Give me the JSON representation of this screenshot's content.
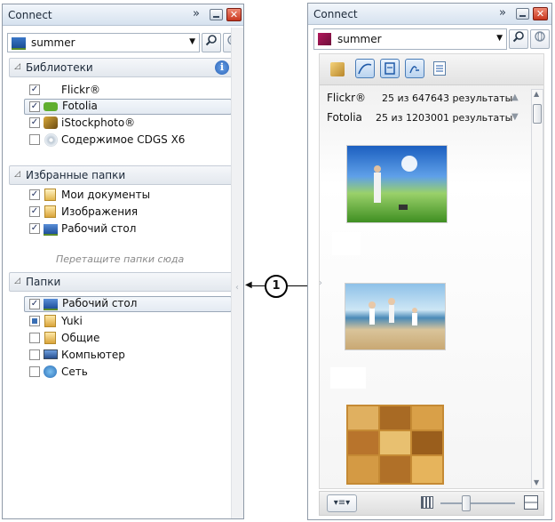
{
  "left_panel": {
    "title": "Connect",
    "search_value": "summer",
    "libraries": {
      "title": "Библиотеки",
      "items": [
        {
          "label": "Flickr®",
          "checked": true
        },
        {
          "label": "Fotolia",
          "checked": true
        },
        {
          "label": "iStockphoto®",
          "checked": true
        },
        {
          "label": "Содержимое CDGS X6",
          "checked": false
        }
      ]
    },
    "favorites": {
      "title": "Избранные папки",
      "items": [
        {
          "label": "Мои документы",
          "checked": true
        },
        {
          "label": "Изображения",
          "checked": true
        },
        {
          "label": "Рабочий стол",
          "checked": true
        }
      ],
      "drop_hint": "Перетащите папки сюда"
    },
    "folders": {
      "title": "Папки",
      "items": [
        {
          "label": "Рабочий стол",
          "checked": true
        },
        {
          "label": "Yuki",
          "checked": "partial"
        },
        {
          "label": "Общие",
          "checked": false
        },
        {
          "label": "Компьютер",
          "checked": false
        },
        {
          "label": "Сеть",
          "checked": false
        }
      ]
    }
  },
  "right_panel": {
    "title": "Connect",
    "search_value": "summer",
    "results": [
      {
        "source": "Flickr®",
        "summary": "25 из 647643 результаты"
      },
      {
        "source": "Fotolia",
        "summary": "25 из 1203001 результаты"
      }
    ]
  },
  "callout": {
    "number": "1"
  },
  "colors": {
    "accent": "#3a6fb5",
    "close": "#c8371f"
  }
}
